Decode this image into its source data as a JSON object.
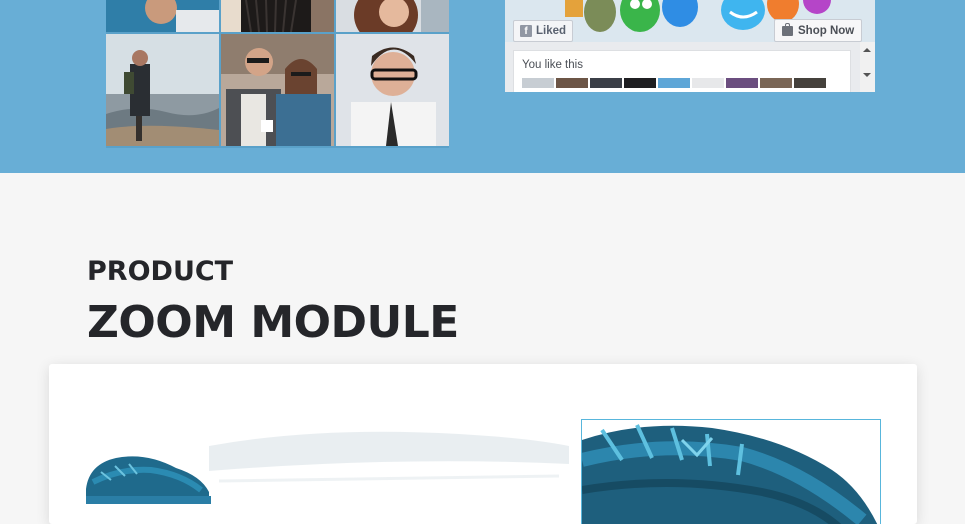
{
  "facebook_widget": {
    "liked_label": "Liked",
    "shop_now_label": "Shop Now",
    "you_like_this": "You like this"
  },
  "section": {
    "label": "PRODUCT",
    "title": "ZOOM MODULE"
  },
  "colors": {
    "hero_background": "#68aed6",
    "page_background": "#f6f6f6",
    "heading_text": "#25262a",
    "zoom_border": "#58b6dc"
  },
  "icons": {
    "liked": "facebook-f-icon",
    "shop": "shopping-bag-icon",
    "scroll_up": "scroll-up-arrow-icon",
    "scroll_down": "scroll-down-arrow-icon"
  }
}
